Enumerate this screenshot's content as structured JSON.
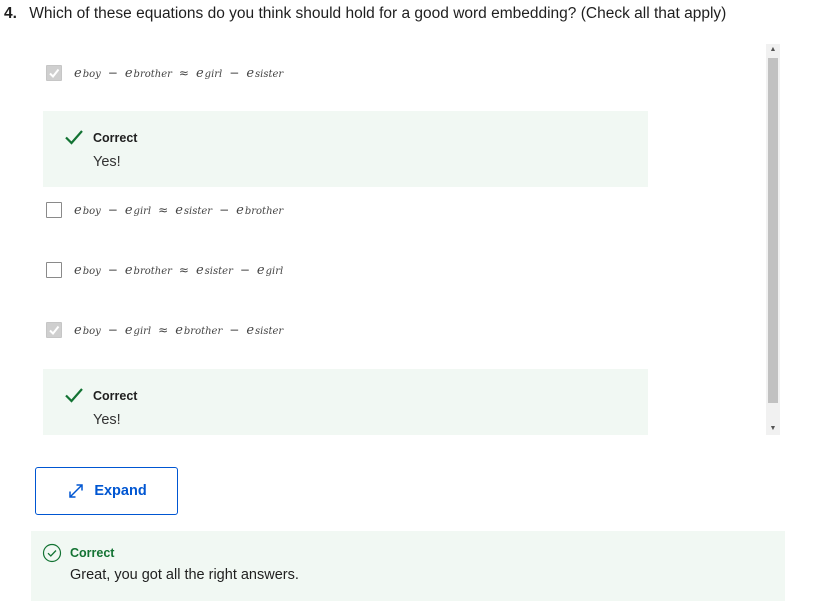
{
  "question": {
    "number": "4.",
    "text": "Which of these equations do you think should hold for a good word embedding? (Check all that apply)"
  },
  "options": [
    {
      "checked": true,
      "terms": [
        "boy",
        "brother",
        "girl",
        "sister"
      ]
    },
    {
      "checked": false,
      "terms": [
        "boy",
        "girl",
        "sister",
        "brother"
      ]
    },
    {
      "checked": false,
      "terms": [
        "boy",
        "brother",
        "sister",
        "girl"
      ]
    },
    {
      "checked": true,
      "terms": [
        "boy",
        "girl",
        "brother",
        "sister"
      ]
    }
  ],
  "symbols": {
    "e": "e",
    "minus": "−",
    "approx": "≈"
  },
  "feedback": [
    {
      "title": "Correct",
      "text": "Yes!"
    },
    {
      "title": "Correct",
      "text": "Yes!"
    }
  ],
  "expand_button": {
    "label": "Expand"
  },
  "overall": {
    "title": "Correct",
    "text": "Great, you got all the right answers."
  },
  "colors": {
    "accent_blue": "#0056d2",
    "success_green": "#137333",
    "feedback_bg": "#f1f8f3"
  }
}
